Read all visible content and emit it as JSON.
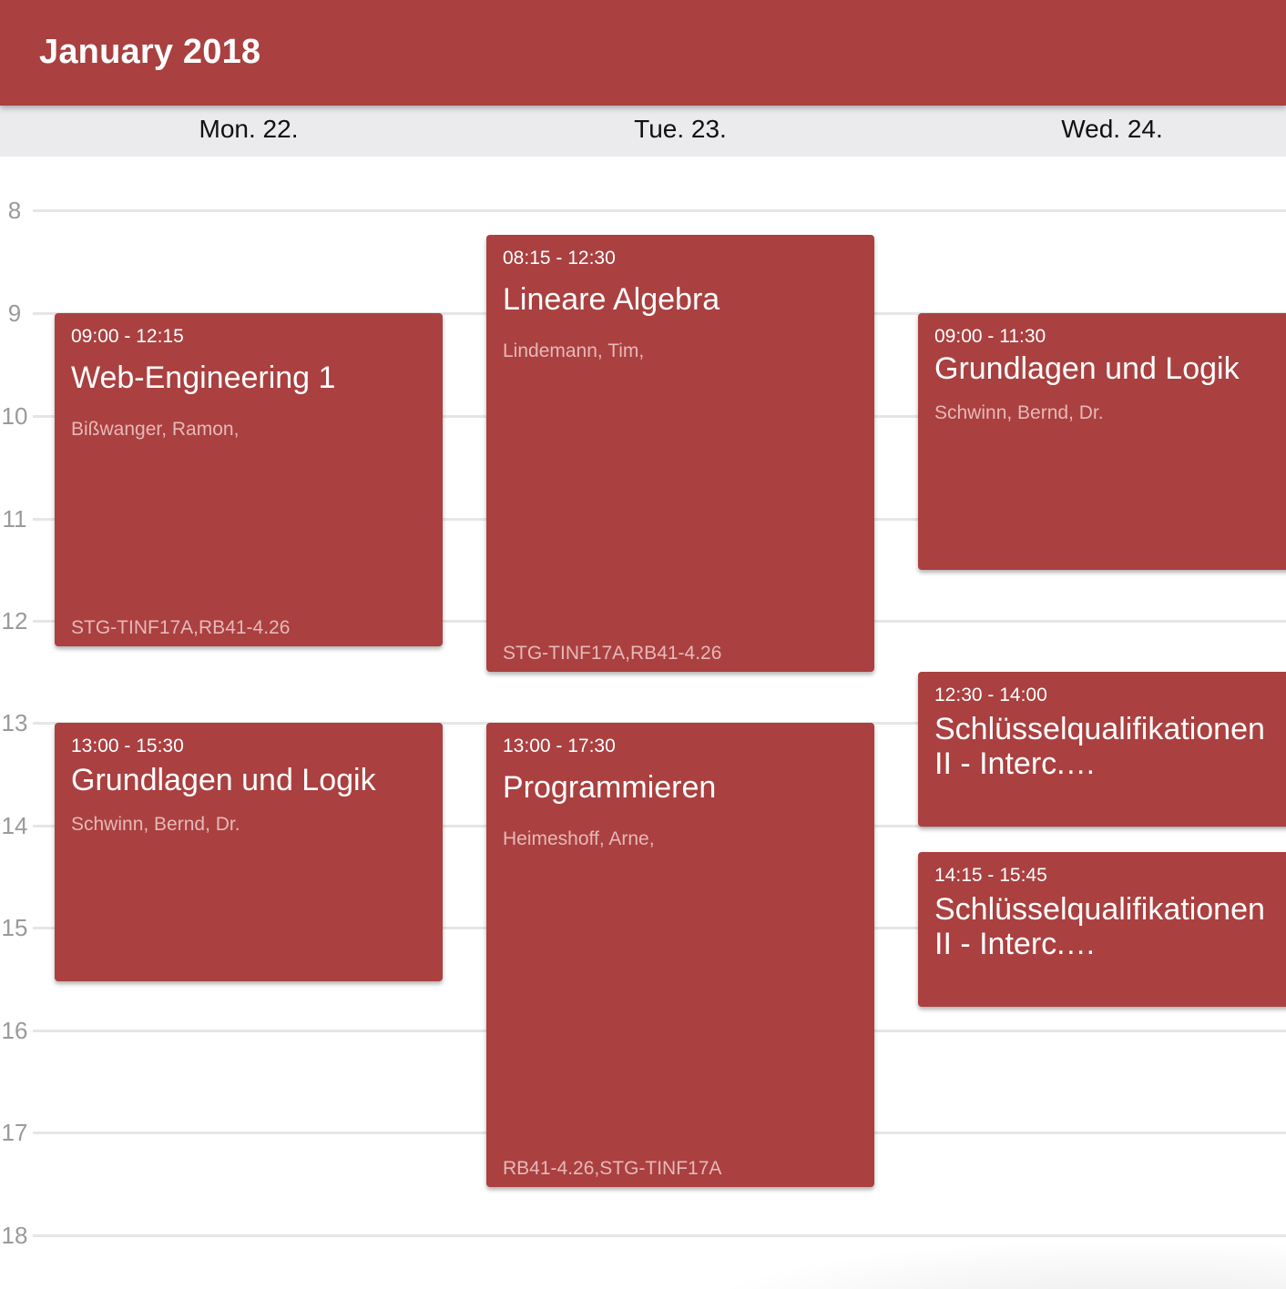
{
  "header": {
    "title": "January 2018"
  },
  "days": [
    {
      "label": "Mon. 22."
    },
    {
      "label": "Tue. 23."
    },
    {
      "label": "Wed. 24."
    }
  ],
  "hours": [
    "8",
    "9",
    "10",
    "11",
    "12",
    "13",
    "14",
    "15",
    "16",
    "17",
    "18"
  ],
  "events": [
    {
      "time": "09:00 - 12:15",
      "title": "Web-Engineering 1",
      "lecturer": "Bißwanger, Ramon,",
      "room": "STG-TINF17A,RB41-4.26"
    },
    {
      "time": "13:00 - 15:30",
      "title": "Grundlagen und Logik",
      "lecturer": "Schwinn, Bernd, Dr.",
      "room": ""
    },
    {
      "time": "08:15 - 12:30",
      "title": "Lineare Algebra",
      "lecturer": "Lindemann, Tim,",
      "room": "STG-TINF17A,RB41-4.26"
    },
    {
      "time": "13:00 - 17:30",
      "title": "Programmieren",
      "lecturer": "Heimeshoff, Arne,",
      "room": "RB41-4.26,STG-TINF17A"
    },
    {
      "time": "09:00 - 11:30",
      "title": "Grundlagen und Logik",
      "lecturer": "Schwinn, Bernd, Dr.",
      "room": ""
    },
    {
      "time": "12:30 - 14:00",
      "title": "Schlüsselqualifikationen II - Interc.…",
      "lecturer": "",
      "room": ""
    },
    {
      "time": "14:15 - 15:45",
      "title": "Schlüsselqualifikationen II - Interc.…",
      "lecturer": "",
      "room": ""
    }
  ],
  "colors": {
    "accent": "#aa4040",
    "header_bg": "#ebebee",
    "grid_line": "#e6e6e8",
    "hour_label": "#9a9a9a",
    "secondary_text": "#e7b8b8"
  }
}
